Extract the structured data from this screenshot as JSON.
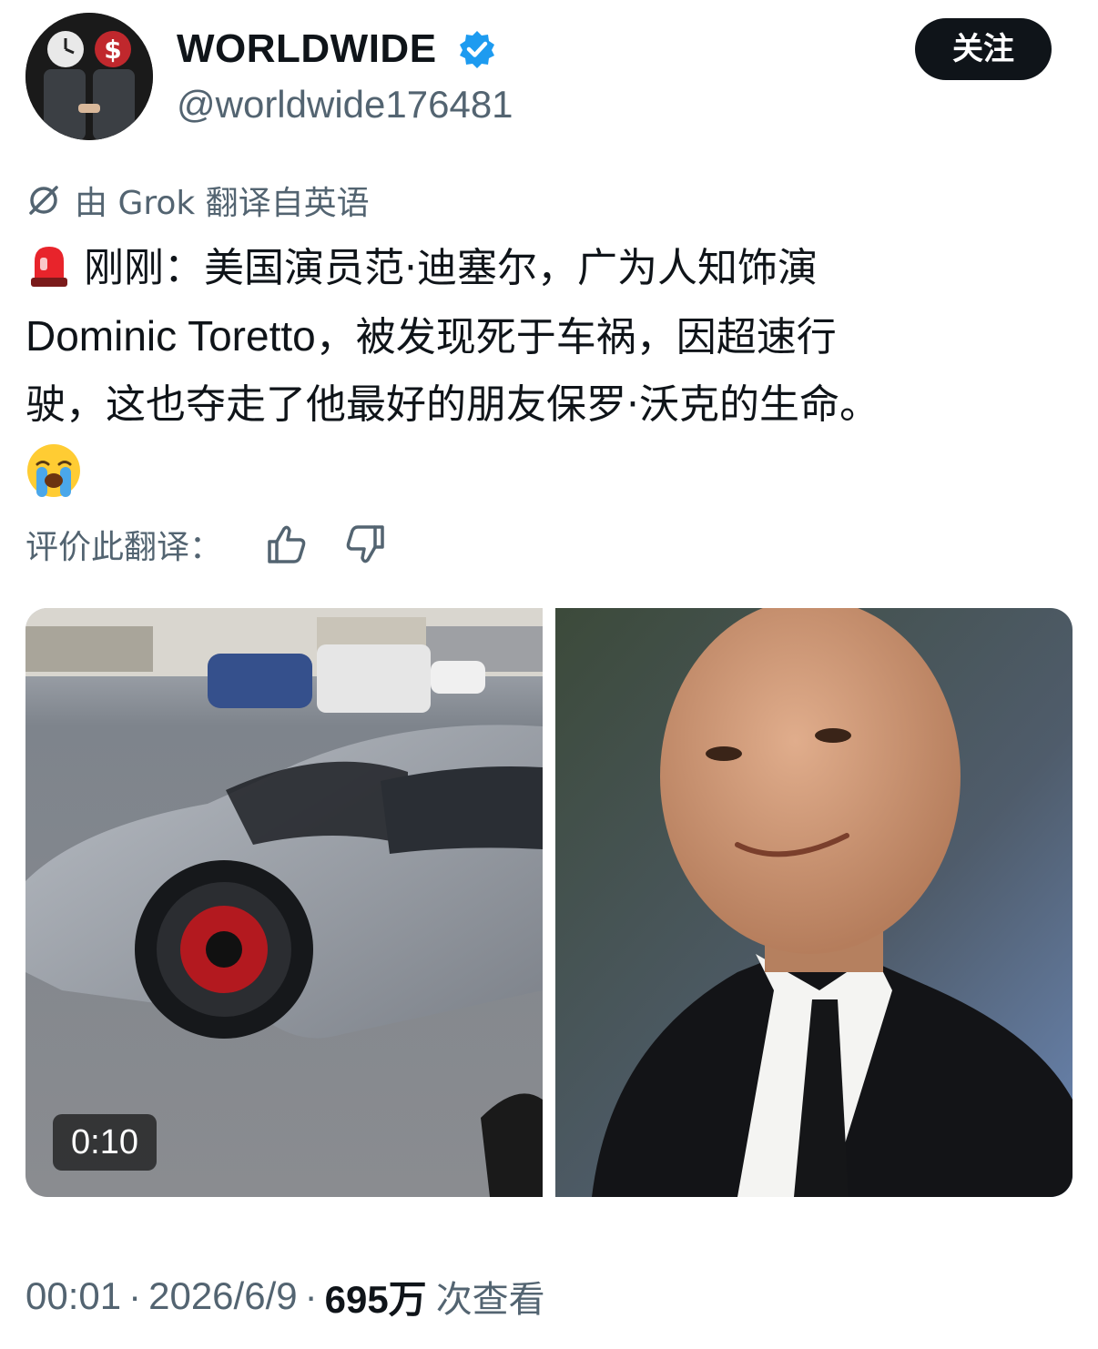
{
  "author": {
    "display_name": "WORLDWIDE",
    "handle": "@worldwide176481",
    "verified": true,
    "avatar_icon": "two-suited-figures-handshake-clock-dollar-heads"
  },
  "header": {
    "follow_label": "关注"
  },
  "translation": {
    "icon": "translate-slash-icon",
    "label": "由 Grok 翻译自英语",
    "rate_label": "评价此翻译："
  },
  "tweet": {
    "siren_icon": "police-siren-emoji",
    "text_line1": "刚刚：美国演员范·迪塞尔，广为人知饰演",
    "text_line2_latin": "Dominic Toretto",
    "text_line2_rest": "，被发现死于车祸，因超速行",
    "text_line3": "驶，这也夺走了他最好的朋友保罗·沃克的生命。",
    "end_emoji": "loudly-crying-face-emoji"
  },
  "media": {
    "video_duration": "0:10",
    "left_image": "silver-sports-car-crashed-on-street-video",
    "right_image": "bald-man-in-black-suit-portrait"
  },
  "meta": {
    "time": "00:01",
    "separator": "·",
    "date": "2026/6/9",
    "views_count": "695万",
    "views_label": "次查看"
  },
  "colors": {
    "text_primary": "#0f1419",
    "text_secondary": "#536471",
    "verified_blue": "#1d9bf0",
    "follow_bg": "#0f1419"
  }
}
